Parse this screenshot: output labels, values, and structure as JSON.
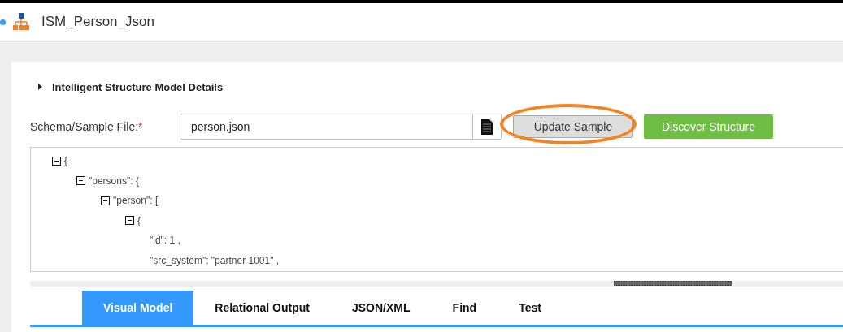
{
  "header": {
    "title": "ISM_Person_Json"
  },
  "section": {
    "title": "Intelligent Structure Model Details",
    "expanded": false
  },
  "form": {
    "label": "Schema/Sample File:",
    "required_mark": "*",
    "value": "person.json"
  },
  "buttons": [
    {
      "kind": "secondary",
      "label": "Update Sample",
      "circled": true
    },
    {
      "kind": "primary",
      "label": "Discover Structure",
      "circled": false
    }
  ],
  "tree": [
    {
      "text": "{",
      "expanded": true,
      "children": [
        {
          "text": "\"persons\": {",
          "expanded": true,
          "children": [
            {
              "text": "\"person\": [",
              "expanded": true,
              "children": [
                {
                  "text": "{",
                  "expanded": true,
                  "children": [
                    {
                      "text": "\"id\": 1 ,"
                    },
                    {
                      "text": "\"src_system\": \"partner 1001\" ,"
                    }
                  ]
                }
              ]
            }
          ]
        }
      ]
    }
  ],
  "tabs": [
    {
      "label": "Visual Model",
      "selected": true
    },
    {
      "label": "Relational Output",
      "selected": false
    },
    {
      "label": "JSON/XML",
      "selected": false
    },
    {
      "label": "Find",
      "selected": false
    },
    {
      "label": "Test",
      "selected": false
    }
  ]
}
